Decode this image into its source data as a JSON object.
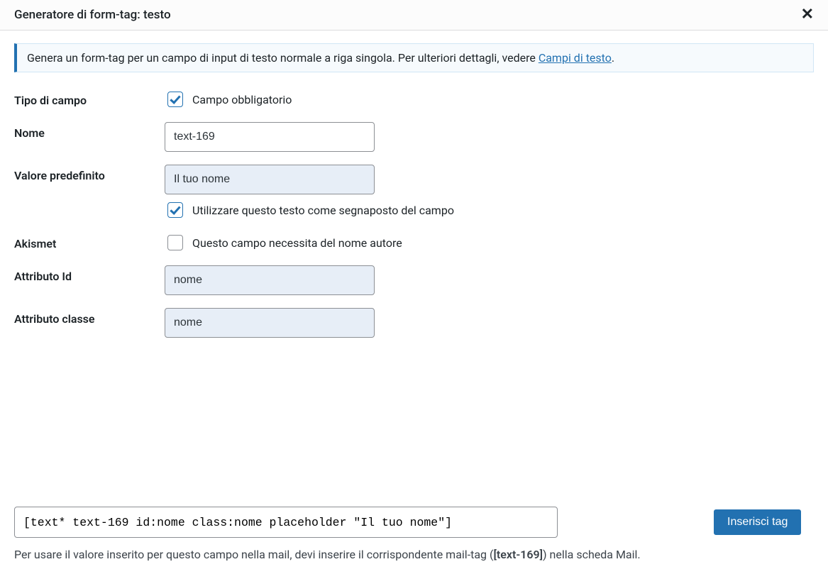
{
  "title": "Generatore di form-tag: testo",
  "info": {
    "prefix": "Genera un form-tag per un campo di input di testo normale a riga singola. Per ulteriori dettagli, vedere ",
    "link_text": "Campi di testo",
    "suffix": "."
  },
  "labels": {
    "tipo_di_campo": "Tipo di campo",
    "nome": "Nome",
    "valore_predefinito": "Valore predefinito",
    "akismet": "Akismet",
    "attributo_id": "Attributo Id",
    "attributo_classe": "Attributo classe"
  },
  "fields": {
    "required": {
      "checked": true,
      "label": "Campo obbligatorio"
    },
    "name_value": "text-169",
    "default_value": "Il tuo nome",
    "placeholder": {
      "checked": true,
      "label": "Utilizzare questo testo come segnaposto del campo"
    },
    "akismet": {
      "checked": false,
      "label": "Questo campo necessita del nome autore"
    },
    "id_attr": "nome",
    "class_attr": "nome"
  },
  "output": {
    "code": "[text* text-169 id:nome class:nome placeholder \"Il tuo nome\"]",
    "button": "Inserisci tag"
  },
  "hint": {
    "before": "Per usare il valore inserito per questo campo nella mail, devi inserire il corrispondente mail-tag (",
    "tag": "[text-169]",
    "after": ") nella scheda Mail."
  }
}
